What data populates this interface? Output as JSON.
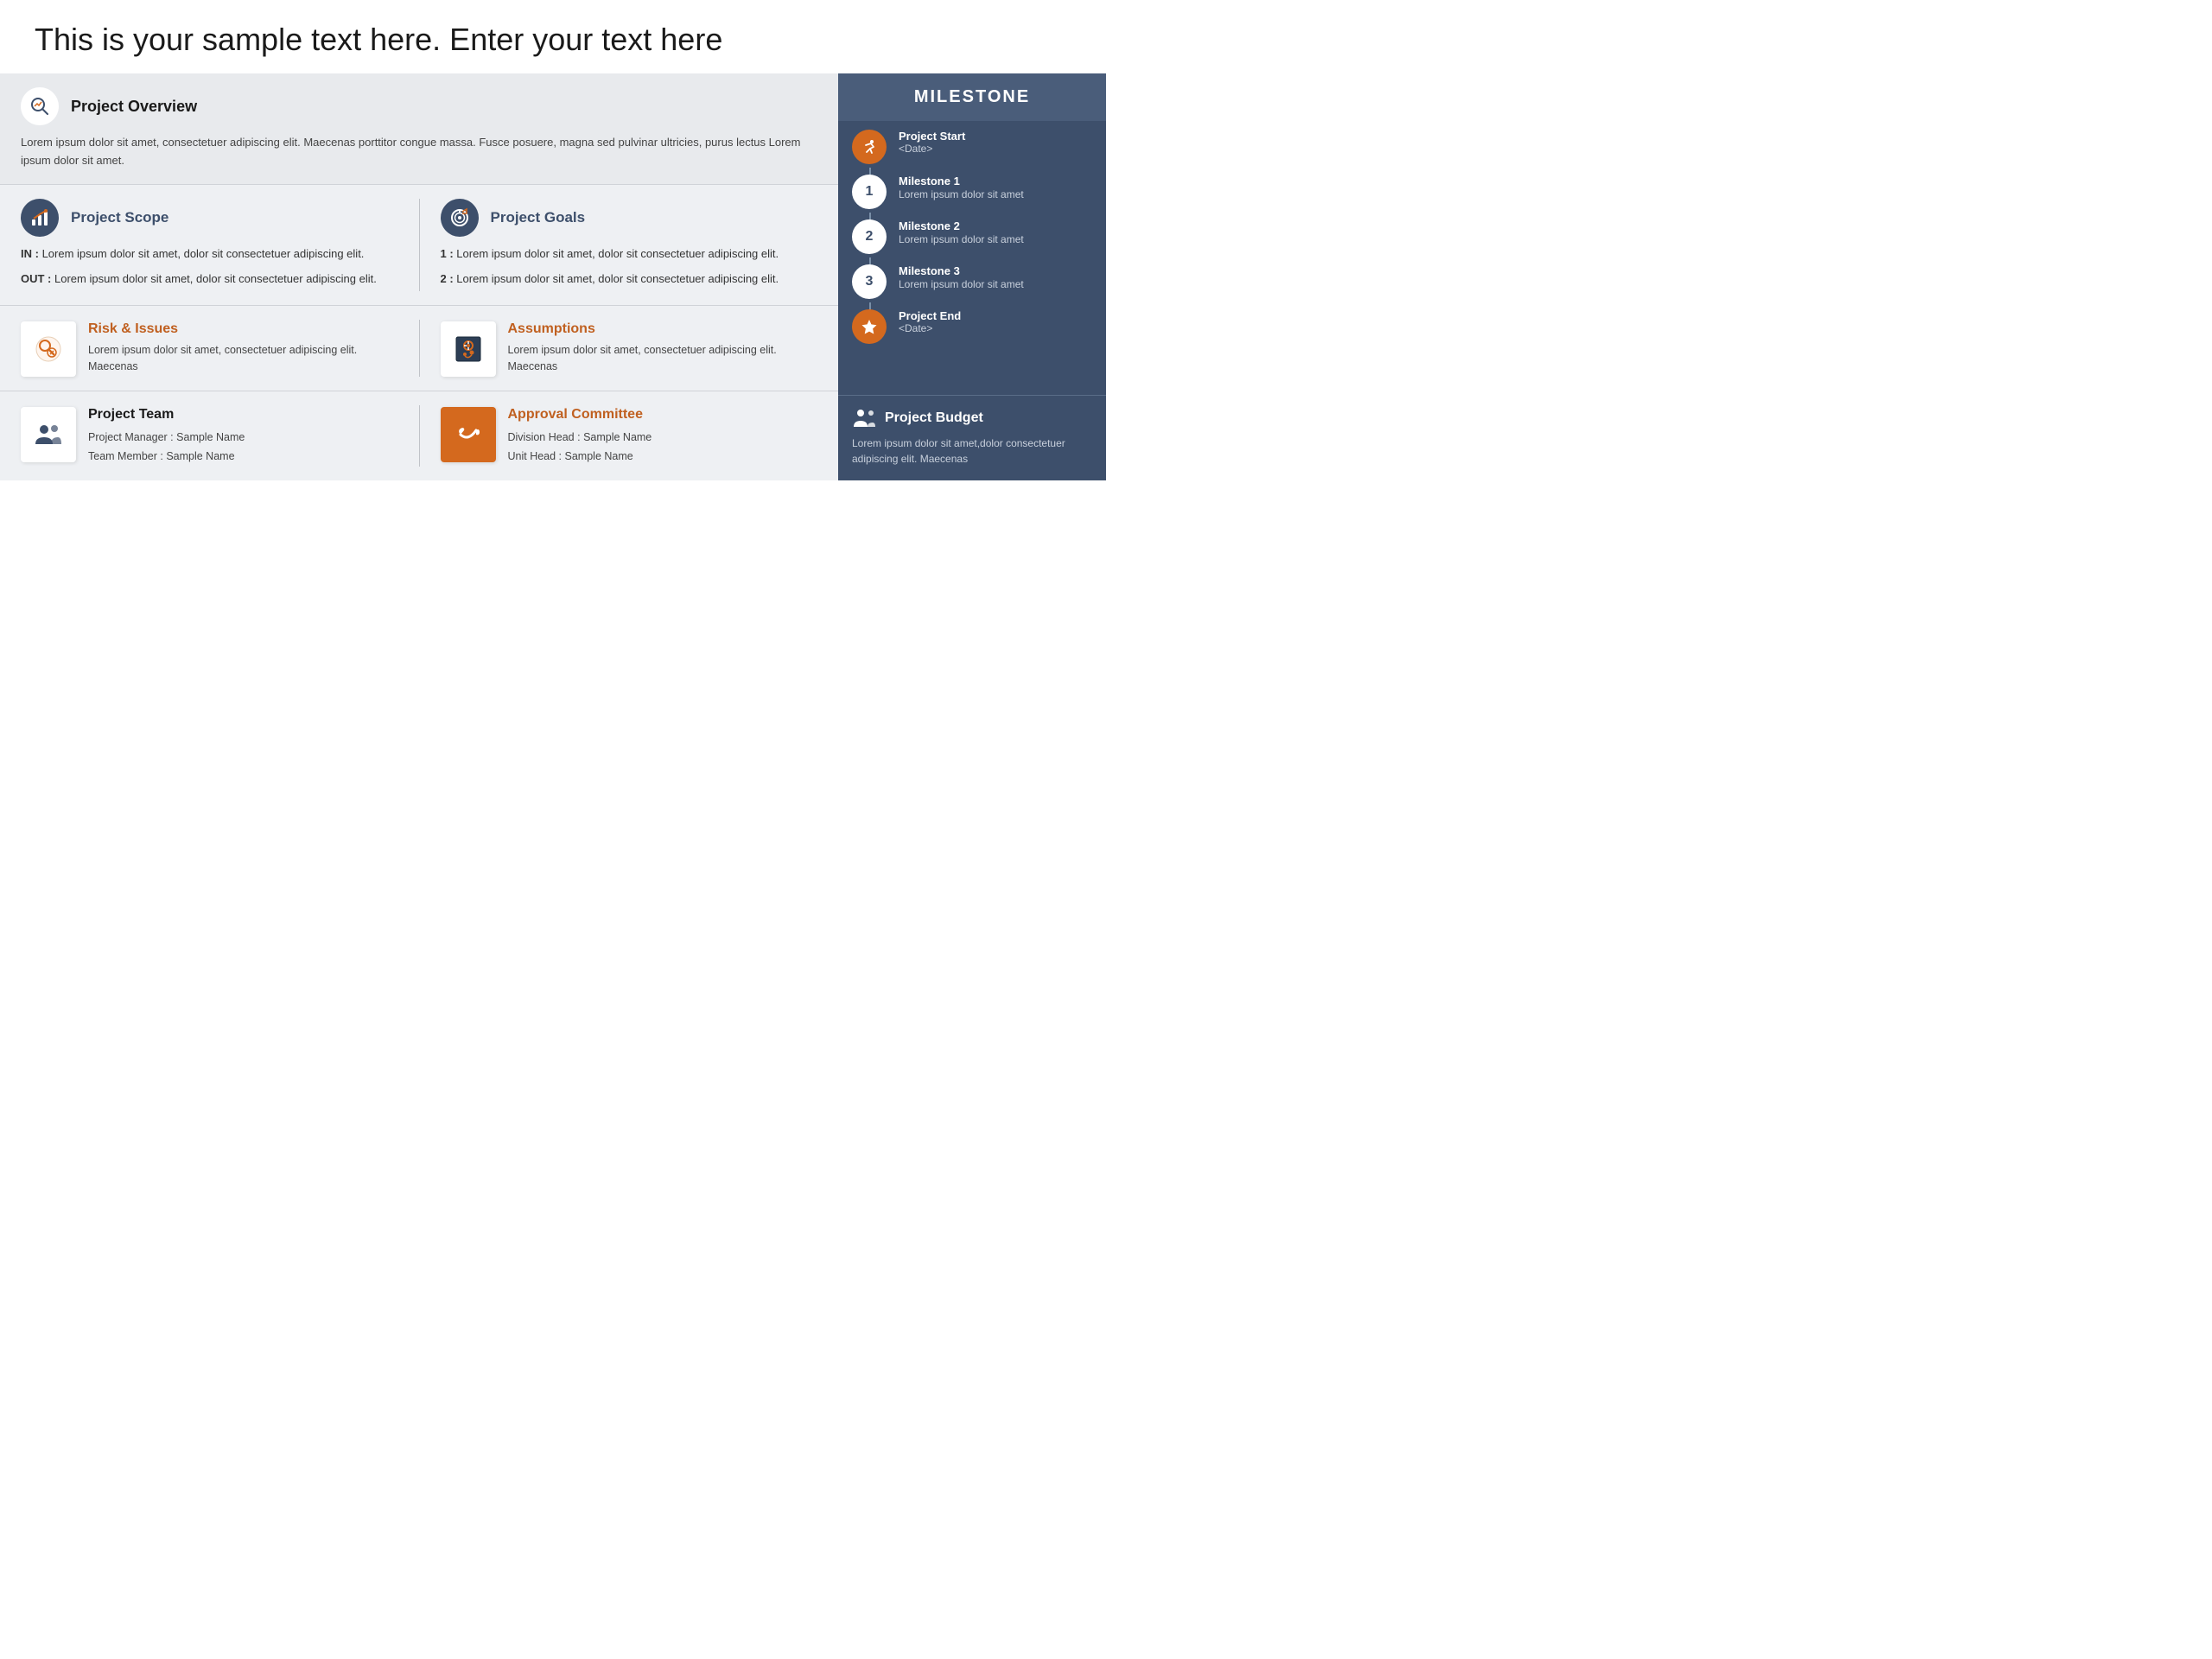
{
  "page": {
    "title": "This is your sample text here. Enter your text here"
  },
  "overview": {
    "title": "Project Overview",
    "text": "Lorem ipsum dolor sit amet, consectetuer adipiscing elit. Maecenas porttitor congue massa. Fusce posuere, magna sed pulvinar ultricies, purus lectus Lorem ipsum dolor sit amet."
  },
  "scope": {
    "title": "Project Scope",
    "in_label": "IN :",
    "in_text": "Lorem ipsum dolor sit amet, dolor sit consectetuer adipiscing elit.",
    "out_label": "OUT :",
    "out_text": "Lorem ipsum dolor sit amet, dolor sit consectetuer adipiscing elit."
  },
  "goals": {
    "title": "Project Goals",
    "item1_label": "1 :",
    "item1_text": "Lorem ipsum dolor sit amet, dolor sit consectetuer adipiscing elit.",
    "item2_label": "2 :",
    "item2_text": "Lorem ipsum dolor sit amet, dolor sit consectetuer adipiscing elit."
  },
  "risk": {
    "title": "Risk & Issues",
    "text": "Lorem ipsum dolor sit amet, consectetuer adipiscing elit. Maecenas"
  },
  "assumptions": {
    "title": "Assumptions",
    "text": "Lorem ipsum dolor sit amet, consectetuer adipiscing elit. Maecenas"
  },
  "team": {
    "title": "Project Team",
    "manager_label": "Project Manager :",
    "manager_name": "Sample Name",
    "member_label": "Team Member :",
    "member_name": "Sample Name"
  },
  "approval": {
    "title": "Approval Committee",
    "division_label": "Division Head :",
    "division_name": "Sample Name",
    "unit_label": "Unit Head :",
    "unit_name": "Sample Name"
  },
  "milestone": {
    "header": "MILESTONE",
    "items": [
      {
        "type": "orange",
        "icon": "run",
        "label": "Project Start",
        "sub": "<Date>"
      },
      {
        "type": "white",
        "icon": "1",
        "label": "Milestone 1",
        "sub": "Lorem ipsum dolor sit amet"
      },
      {
        "type": "white",
        "icon": "2",
        "label": "Milestone 2",
        "sub": "Lorem ipsum dolor sit amet"
      },
      {
        "type": "white",
        "icon": "3",
        "label": "Milestone 3",
        "sub": "Lorem ipsum dolor sit amet"
      },
      {
        "type": "orange",
        "icon": "star",
        "label": "Project End",
        "sub": "<Date>"
      }
    ]
  },
  "budget": {
    "title": "Project Budget",
    "text": "Lorem ipsum dolor sit amet,dolor consectetuer adipiscing elit. Maecenas"
  },
  "colors": {
    "orange": "#d4691e",
    "dark_blue": "#3d4f6b",
    "light_bg": "#eef0f3",
    "text_dark": "#1a1a1a"
  }
}
